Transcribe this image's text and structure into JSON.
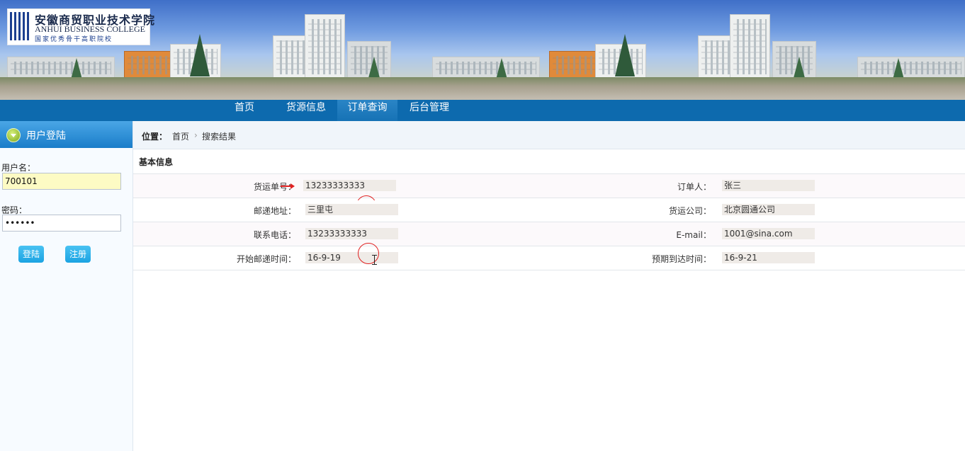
{
  "logo": {
    "name_cn": "安徽商贸职业技术学院",
    "name_en": "ANHUI BUSINESS COLLEGE",
    "tagline": "国家优秀骨干高职院校"
  },
  "nav": {
    "items": [
      "首页",
      "货源信息",
      "订单查询",
      "后台管理"
    ],
    "active_index": 2
  },
  "login": {
    "title": "用户登陆",
    "username_label": "用户名：",
    "username_value": "700101",
    "password_label": "密码：",
    "password_value": "••••••",
    "login_button": "登陆",
    "register_button": "注册"
  },
  "breadcrumb": {
    "label": "位置：",
    "home": "首页",
    "separator": "›",
    "current": "搜索结果"
  },
  "section_title": "基本信息",
  "fields": {
    "waybill_label": "货运单号：",
    "waybill_value": "13233333333",
    "orderer_label": "订单人：",
    "orderer_value": "张三",
    "address_label": "邮递地址：",
    "address_value": "三里屯",
    "company_label": "货运公司：",
    "company_value": "北京圆通公司",
    "phone_label": "联系电话：",
    "phone_value": "13233333333",
    "email_label": "E-mail：",
    "email_value": "1001@sina.com",
    "start_label": "开始邮递时间：",
    "start_value": "16-9-19",
    "arrival_label": "预期到达时间：",
    "arrival_value": "16-9-21"
  },
  "colors": {
    "nav_bg": "#0d6aae",
    "login_header": "#1a7dc9",
    "button": "#1ba3e2",
    "field_bg": "#efebe7",
    "username_bg": "#fdfbc4"
  }
}
